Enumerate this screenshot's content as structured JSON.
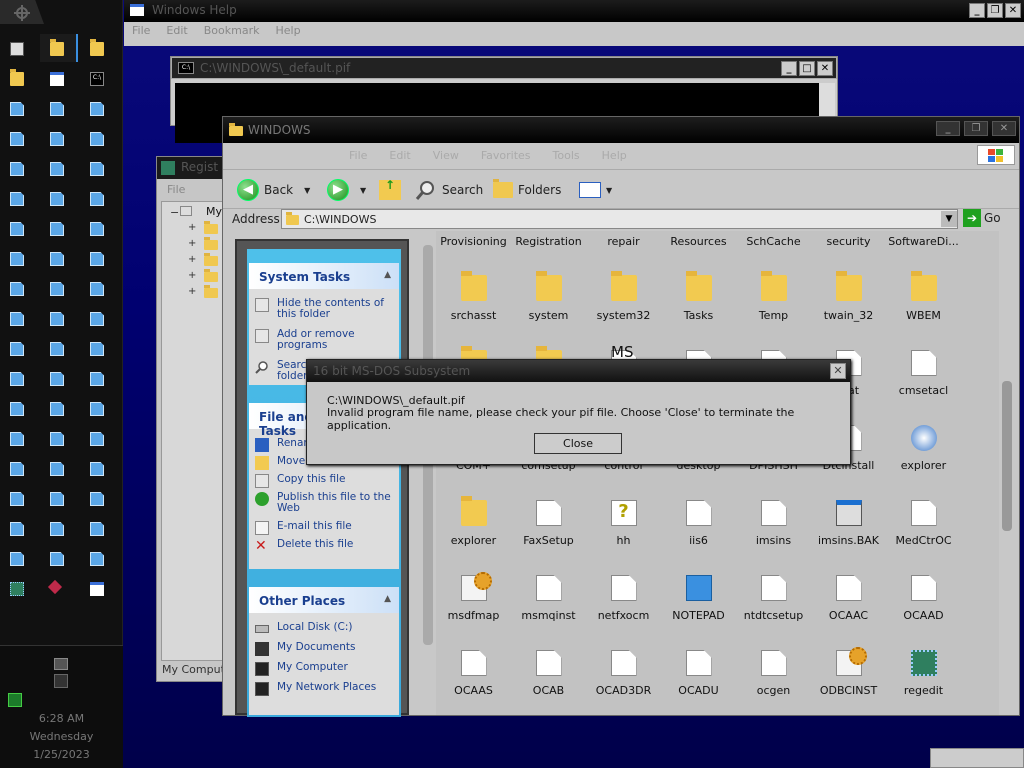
{
  "taskbar": {
    "clock_time": "6:28 AM",
    "clock_day": "Wednesday",
    "clock_date": "1/25/2023"
  },
  "help_window": {
    "title": "Windows Help",
    "menu": [
      "File",
      "Edit",
      "Bookmark",
      "Help"
    ]
  },
  "dos_window": {
    "title": "C:\\WINDOWS\\_default.pif"
  },
  "registry_window": {
    "title": "Regist",
    "tree_root": "My",
    "status": "My Comput"
  },
  "explorer": {
    "title": "WINDOWS",
    "menu": [
      "File",
      "Edit",
      "View",
      "Favorites",
      "Tools",
      "Help"
    ],
    "toolbar": {
      "back": "Back",
      "search": "Search",
      "folders": "Folders"
    },
    "address_label": "Address",
    "address_value": "C:\\WINDOWS",
    "go": "Go",
    "system_tasks": {
      "header": "System Tasks",
      "items": [
        "Hide the contents of this folder",
        "Add or remove programs",
        "Search for files or folders"
      ]
    },
    "file_tasks": {
      "header": "File and Folder Tasks",
      "items": [
        "Rename this file",
        "Move this file",
        "Copy this file",
        "Publish this file to the Web",
        "E-mail this file",
        "Delete this file"
      ]
    },
    "other_places": {
      "header": "Other Places",
      "items": [
        "Local Disk (C:)",
        "My Documents",
        "My Computer",
        "My Network Places"
      ]
    },
    "top_row": [
      "Provisioning",
      "Registration",
      "repair",
      "Resources",
      "SchCache",
      "security",
      "SoftwareDi..."
    ],
    "rows": [
      [
        {
          "name": "srchasst",
          "icon": "folder"
        },
        {
          "name": "system",
          "icon": "folder"
        },
        {
          "name": "system32",
          "icon": "folder"
        },
        {
          "name": "Tasks",
          "icon": "folder"
        },
        {
          "name": "Temp",
          "icon": "folder"
        },
        {
          "name": "twain_32",
          "icon": "folder"
        },
        {
          "name": "WBEM",
          "icon": "folder"
        }
      ],
      [
        {
          "name": "",
          "icon": "folder"
        },
        {
          "name": "",
          "icon": "folder"
        },
        {
          "name": "",
          "icon": "file"
        },
        {
          "name": "",
          "icon": "file"
        },
        {
          "name": "",
          "icon": "file"
        },
        {
          "name": "stat",
          "icon": "file"
        },
        {
          "name": "cmsetacl",
          "icon": "file"
        }
      ],
      [
        {
          "name": "COM+",
          "icon": "file"
        },
        {
          "name": "comsetup",
          "icon": "file"
        },
        {
          "name": "control",
          "icon": "file"
        },
        {
          "name": "desktop",
          "icon": "file"
        },
        {
          "name": "DPISHSH",
          "icon": "file"
        },
        {
          "name": "Dtcinstall",
          "icon": "file"
        },
        {
          "name": "explorer",
          "icon": "explorer"
        }
      ],
      [
        {
          "name": "explorer",
          "icon": "folder"
        },
        {
          "name": "FaxSetup",
          "icon": "file"
        },
        {
          "name": "hh",
          "icon": "help"
        },
        {
          "name": "iis6",
          "icon": "file"
        },
        {
          "name": "imsins",
          "icon": "file"
        },
        {
          "name": "imsins.BAK",
          "icon": "exe"
        },
        {
          "name": "MedCtrOC",
          "icon": "file"
        }
      ],
      [
        {
          "name": "msdfmap",
          "icon": "gear"
        },
        {
          "name": "msmqinst",
          "icon": "file"
        },
        {
          "name": "netfxocm",
          "icon": "file"
        },
        {
          "name": "NOTEPAD",
          "icon": "notepad"
        },
        {
          "name": "ntdtcsetup",
          "icon": "file"
        },
        {
          "name": "OCAAC",
          "icon": "file"
        },
        {
          "name": "OCAAD",
          "icon": "file"
        }
      ],
      [
        {
          "name": "OCAAS",
          "icon": "file"
        },
        {
          "name": "OCAB",
          "icon": "file"
        },
        {
          "name": "OCAD3DR",
          "icon": "file"
        },
        {
          "name": "OCADU",
          "icon": "file"
        },
        {
          "name": "ocgen",
          "icon": "file"
        },
        {
          "name": "ODBCINST",
          "icon": "gear"
        },
        {
          "name": "regedit",
          "icon": "cube"
        }
      ]
    ]
  },
  "ms_label": "MS",
  "dialog": {
    "title": "16 bit MS-DOS Subsystem",
    "line1": "C:\\WINDOWS\\_default.pif",
    "line2": "Invalid program file name, please check your pif file. Choose 'Close' to terminate the application.",
    "button": "Close"
  }
}
